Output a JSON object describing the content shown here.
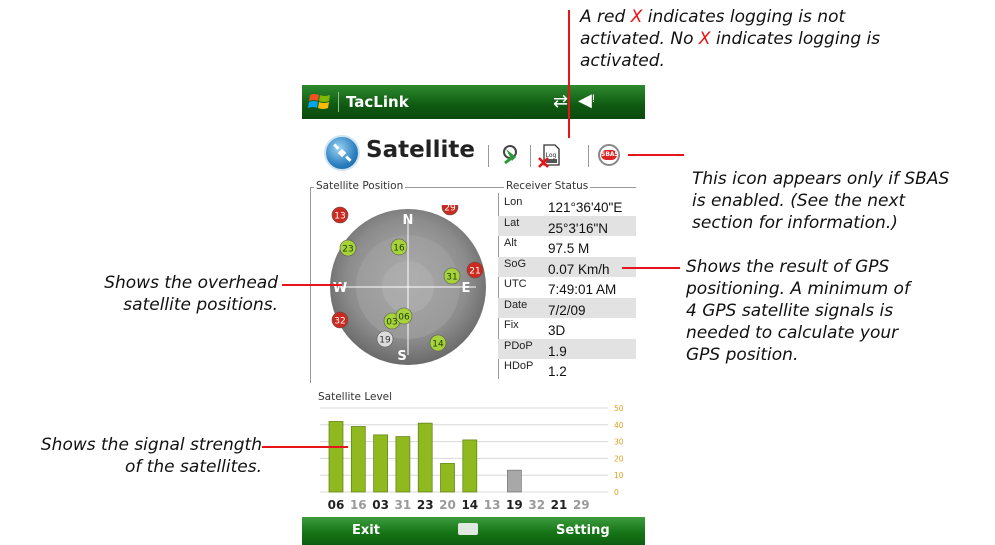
{
  "callouts": {
    "logging_line1_pre": "A red ",
    "logging_x": "X",
    "logging_line1_post": " indicates logging is not",
    "logging_line2_pre": "activated. No ",
    "logging_line2_post": " indicates logging is",
    "logging_line3": "activated.",
    "sbas_line1": "This icon appears only if SBAS",
    "sbas_line2": "is enabled. (See the next",
    "sbas_line3": "section for information.)",
    "overhead_line1": "Shows the overhead",
    "overhead_line2": "satellite positions.",
    "result_line1": "Shows the result of GPS",
    "result_line2": "positioning. A minimum of",
    "result_line3": "4 GPS satellite signals is",
    "result_line4": "needed to calculate your",
    "result_line5": "GPS position.",
    "signal_line1": "Shows the signal strength",
    "signal_line2": "of the satellites."
  },
  "titlebar": {
    "app_name": "TacLink",
    "icons": [
      "windows-start-icon",
      "connectivity-icon",
      "speaker-icon"
    ]
  },
  "header": {
    "title": "Satellite",
    "icons": [
      "satellite-logo-icon",
      "gps-tool-icon",
      "log-icon",
      "sbas-icon"
    ],
    "sbas_label": "SBAS",
    "log_label": "Log"
  },
  "satellite_position": {
    "label": "Satellite Position",
    "compass": {
      "n": "N",
      "e": "E",
      "s": "S",
      "w": "W"
    },
    "satellites": [
      {
        "id": "13",
        "status": "red"
      },
      {
        "id": "29",
        "status": "red"
      },
      {
        "id": "23",
        "status": "green"
      },
      {
        "id": "16",
        "status": "green"
      },
      {
        "id": "31",
        "status": "green"
      },
      {
        "id": "21",
        "status": "red"
      },
      {
        "id": "20",
        "status": "green"
      },
      {
        "id": "32",
        "status": "red"
      },
      {
        "id": "03",
        "status": "green"
      },
      {
        "id": "06",
        "status": "green"
      },
      {
        "id": "19",
        "status": "gray"
      },
      {
        "id": "14",
        "status": "green"
      }
    ]
  },
  "receiver_status": {
    "label": "Receiver Status",
    "rows": [
      {
        "label": "Lon",
        "value": "121°36'40\"E"
      },
      {
        "label": "Lat",
        "value": "25°3'16\"N"
      },
      {
        "label": "Alt",
        "value": "97.5 M"
      },
      {
        "label": "SoG",
        "value": "0.07 Km/h"
      },
      {
        "label": "UTC",
        "value": "7:49:01 AM"
      },
      {
        "label": "Date",
        "value": "7/2/09"
      },
      {
        "label": "Fix",
        "value": "3D"
      },
      {
        "label": "PDoP",
        "value": "1.9"
      },
      {
        "label": "HDoP",
        "value": "1.2"
      }
    ]
  },
  "satellite_level": {
    "label": "Satellite Level",
    "axis_ticks": [
      "50",
      "40",
      "30",
      "20",
      "10",
      "0"
    ],
    "bars": [
      {
        "id": "06",
        "value": 42,
        "status": "used"
      },
      {
        "id": "16",
        "value": 39,
        "status": "used"
      },
      {
        "id": "03",
        "value": 34,
        "status": "used"
      },
      {
        "id": "31",
        "value": 33,
        "status": "used"
      },
      {
        "id": "23",
        "value": 41,
        "status": "used"
      },
      {
        "id": "20",
        "value": 17,
        "status": "used"
      },
      {
        "id": "14",
        "value": 31,
        "status": "used"
      },
      {
        "id": "13",
        "value": 0,
        "status": "none"
      },
      {
        "id": "19",
        "value": 13,
        "status": "gray"
      },
      {
        "id": "32",
        "value": 0,
        "status": "none"
      },
      {
        "id": "21",
        "value": 0,
        "status": "none"
      },
      {
        "id": "29",
        "value": 0,
        "status": "none"
      }
    ]
  },
  "bottombar": {
    "left": "Exit",
    "right": "Setting",
    "center_icon": "keyboard-icon"
  },
  "colors": {
    "titlebar": "#0f5a12",
    "accent_red": "#e8141c",
    "bar_green": "#8fb91f",
    "tick_orange": "#e0a020"
  }
}
